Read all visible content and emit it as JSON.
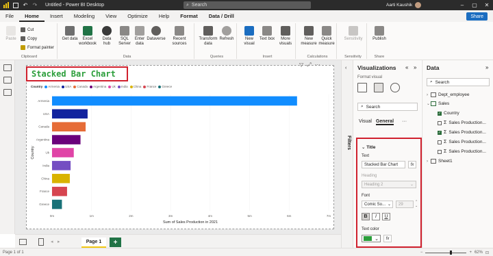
{
  "titlebar": {
    "title": "Untitled - Power BI Desktop",
    "search": "Search",
    "user": "Aarti Kaushik"
  },
  "menu": {
    "items": [
      "File",
      "Home",
      "Insert",
      "Modeling",
      "View",
      "Optimize",
      "Help",
      "Format",
      "Data / Drill"
    ],
    "active": "Home",
    "share": "Share"
  },
  "ribbon": {
    "clipboard": {
      "paste": "Paste",
      "cut": "Cut",
      "copy": "Copy",
      "format_painter": "Format painter",
      "label": "Clipboard"
    },
    "data": {
      "get_data": "Get data",
      "excel": "Excel workbook",
      "data_hub": "Data hub",
      "sql": "SQL Server",
      "enter_data": "Enter data",
      "dataverse": "Dataverse",
      "recent": "Recent sources",
      "label": "Data"
    },
    "queries": {
      "transform": "Transform data",
      "refresh": "Refresh",
      "label": "Queries"
    },
    "insert": {
      "new_visual": "New visual",
      "text_box": "Text box",
      "more_visuals": "More visuals",
      "label": "Insert"
    },
    "calculations": {
      "new_measure": "New measure",
      "quick_measure": "Quick measure",
      "label": "Calculations"
    },
    "sensitivity": {
      "sensitivity": "Sensitivity",
      "label": "Sensitivity"
    },
    "share": {
      "publish": "Publish",
      "label": "Share"
    }
  },
  "visual": {
    "title": "Stacked Bar Chart",
    "legend_title": "Country"
  },
  "chart_data": {
    "type": "bar",
    "orientation": "horizontal",
    "title": "Stacked Bar Chart",
    "xlabel": "Sum of Sales Production in 2021",
    "ylabel": "Country",
    "categories": [
      "Armenia",
      "USA",
      "Canada",
      "Argentina",
      "Uk",
      "India",
      "China",
      "France",
      "Greece"
    ],
    "values": [
      6.2,
      0.9,
      0.85,
      0.72,
      0.55,
      0.47,
      0.45,
      0.38,
      0.25
    ],
    "colors": [
      "#118dff",
      "#12239e",
      "#e66c37",
      "#6b007b",
      "#e044a7",
      "#744ec2",
      "#d9b300",
      "#d64550",
      "#197278"
    ],
    "xticks": [
      "0m",
      "1m",
      "2m",
      "3m",
      "4m",
      "5m",
      "6m",
      "7m"
    ],
    "xlim": [
      0,
      7
    ]
  },
  "pages": {
    "current": "Page 1",
    "add": "+"
  },
  "status": {
    "page": "Page 1 of 1",
    "zoom": "62%"
  },
  "filters": {
    "label": "Filters"
  },
  "viz_panel": {
    "title": "Visualizations",
    "subtitle": "Format visual",
    "search": "Search",
    "tab_visual": "Visual",
    "tab_general": "General",
    "more": "···"
  },
  "format": {
    "section": "Title",
    "text_label": "Text",
    "text_value": "Stacked Bar Chart",
    "heading_label": "Heading",
    "heading_value": "Heading 2",
    "font_label": "Font",
    "font_value": "Comic So...",
    "font_size": "29",
    "bold": "B",
    "italic": "I",
    "underline": "U",
    "text_color_label": "Text color",
    "fx": "fx",
    "text_color": "#2b9e3a"
  },
  "data_panel": {
    "title": "Data",
    "search": "Search",
    "tables": [
      {
        "name": "Dept_employee",
        "expanded": false
      },
      {
        "name": "Sales",
        "expanded": true,
        "fields": [
          {
            "name": "Country",
            "checked": true,
            "sigma": false
          },
          {
            "name": "Sales Production...",
            "checked": false,
            "sigma": true
          },
          {
            "name": "Sales Production...",
            "checked": true,
            "sigma": true
          },
          {
            "name": "Sales Production...",
            "checked": false,
            "sigma": true
          },
          {
            "name": "Sales Production...",
            "checked": false,
            "sigma": true
          }
        ]
      },
      {
        "name": "Sheet1",
        "expanded": false
      }
    ]
  }
}
